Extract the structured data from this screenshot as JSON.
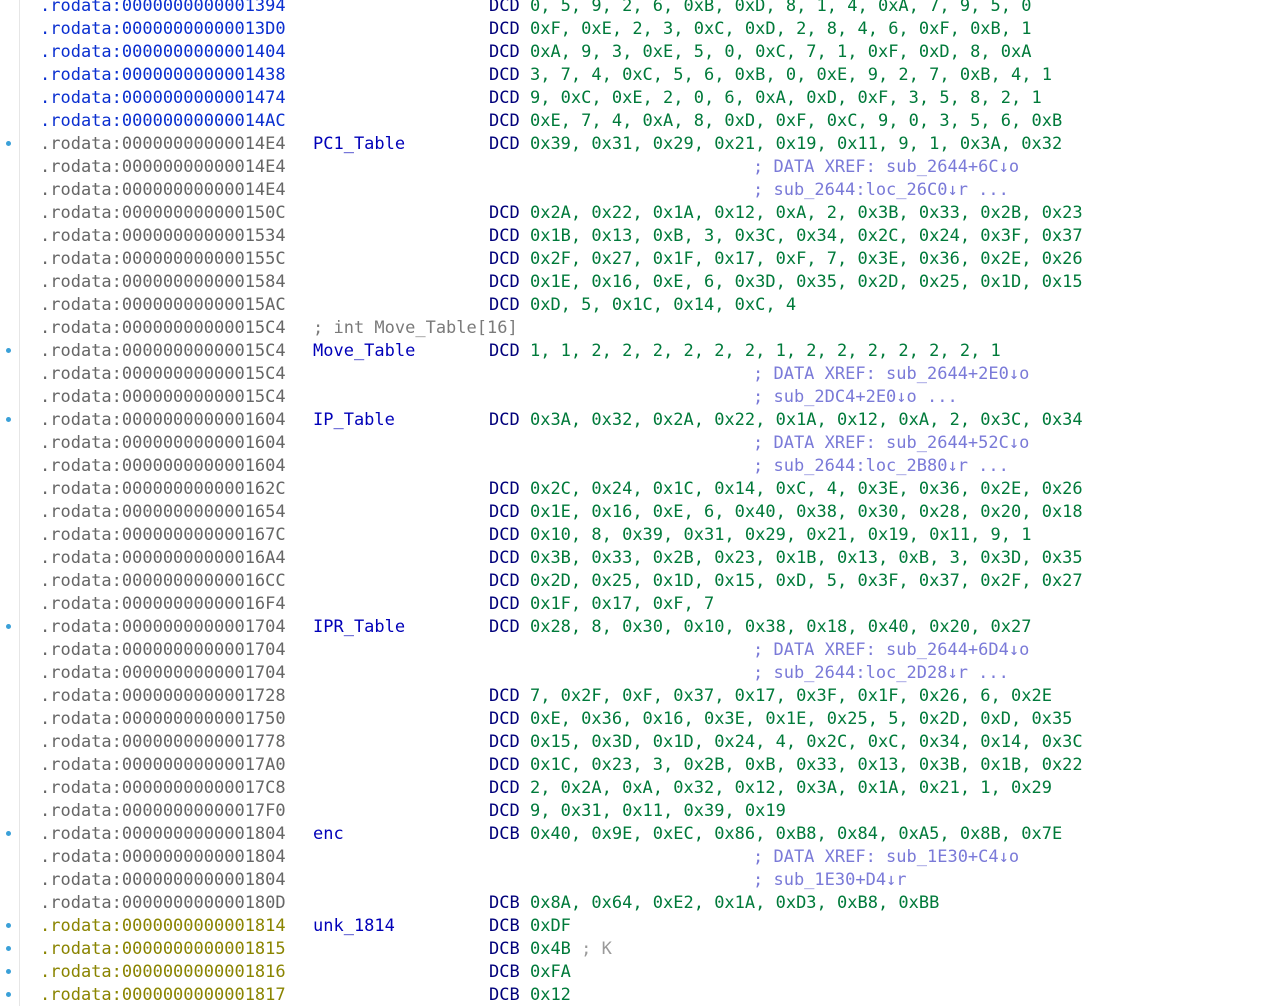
{
  "rows": [
    {
      "addr": ".rodata:0000000000001394",
      "addr_color": "blue",
      "dot": false,
      "label": "",
      "comment_label": "",
      "mnem": "DCD",
      "ops": "0, 5, 9, 2, 6, 0xB, 0xD, 8, 1, 4, 0xA, 7, 9, 5, 0",
      "inline_comment": "",
      "xref": ""
    },
    {
      "addr": ".rodata:00000000000013D0",
      "addr_color": "blue",
      "dot": false,
      "label": "",
      "comment_label": "",
      "mnem": "DCD",
      "ops": "0xF, 0xE, 2, 3, 0xC, 0xD, 2, 8, 4, 6, 0xF, 0xB, 1",
      "inline_comment": "",
      "xref": ""
    },
    {
      "addr": ".rodata:0000000000001404",
      "addr_color": "blue",
      "dot": false,
      "label": "",
      "comment_label": "",
      "mnem": "DCD",
      "ops": "0xA, 9, 3, 0xE, 5, 0, 0xC, 7, 1, 0xF, 0xD, 8, 0xA",
      "inline_comment": "",
      "xref": ""
    },
    {
      "addr": ".rodata:0000000000001438",
      "addr_color": "blue",
      "dot": false,
      "label": "",
      "comment_label": "",
      "mnem": "DCD",
      "ops": "3, 7, 4, 0xC, 5, 6, 0xB, 0, 0xE, 9, 2, 7, 0xB, 4, 1",
      "inline_comment": "",
      "xref": ""
    },
    {
      "addr": ".rodata:0000000000001474",
      "addr_color": "blue",
      "dot": false,
      "label": "",
      "comment_label": "",
      "mnem": "DCD",
      "ops": "9, 0xC, 0xE, 2, 0, 6, 0xA, 0xD, 0xF, 3, 5, 8, 2, 1",
      "inline_comment": "",
      "xref": ""
    },
    {
      "addr": ".rodata:00000000000014AC",
      "addr_color": "blue",
      "dot": false,
      "label": "",
      "comment_label": "",
      "mnem": "DCD",
      "ops": "0xE, 7, 4, 0xA, 8, 0xD, 0xF, 0xC, 9, 0, 3, 5, 6, 0xB",
      "inline_comment": "",
      "xref": ""
    },
    {
      "addr": ".rodata:00000000000014E4",
      "addr_color": "gray",
      "dot": true,
      "label": "PC1_Table",
      "comment_label": "",
      "mnem": "DCD",
      "ops": "0x39, 0x31, 0x29, 0x21, 0x19, 0x11, 9, 1, 0x3A, 0x32",
      "inline_comment": "",
      "xref": ""
    },
    {
      "addr": ".rodata:00000000000014E4",
      "addr_color": "gray",
      "dot": false,
      "label": "",
      "comment_label": "",
      "mnem": "",
      "ops": "",
      "inline_comment": "",
      "xref": "; DATA XREF: sub_2644+6C↓o"
    },
    {
      "addr": ".rodata:00000000000014E4",
      "addr_color": "gray",
      "dot": false,
      "label": "",
      "comment_label": "",
      "mnem": "",
      "ops": "",
      "inline_comment": "",
      "xref": "; sub_2644:loc_26C0↓r ..."
    },
    {
      "addr": ".rodata:000000000000150C",
      "addr_color": "gray",
      "dot": false,
      "label": "",
      "comment_label": "",
      "mnem": "DCD",
      "ops": "0x2A, 0x22, 0x1A, 0x12, 0xA, 2, 0x3B, 0x33, 0x2B, 0x23",
      "inline_comment": "",
      "xref": ""
    },
    {
      "addr": ".rodata:0000000000001534",
      "addr_color": "gray",
      "dot": false,
      "label": "",
      "comment_label": "",
      "mnem": "DCD",
      "ops": "0x1B, 0x13, 0xB, 3, 0x3C, 0x34, 0x2C, 0x24, 0x3F, 0x37",
      "inline_comment": "",
      "xref": ""
    },
    {
      "addr": ".rodata:000000000000155C",
      "addr_color": "gray",
      "dot": false,
      "label": "",
      "comment_label": "",
      "mnem": "DCD",
      "ops": "0x2F, 0x27, 0x1F, 0x17, 0xF, 7, 0x3E, 0x36, 0x2E, 0x26",
      "inline_comment": "",
      "xref": ""
    },
    {
      "addr": ".rodata:0000000000001584",
      "addr_color": "gray",
      "dot": false,
      "label": "",
      "comment_label": "",
      "mnem": "DCD",
      "ops": "0x1E, 0x16, 0xE, 6, 0x3D, 0x35, 0x2D, 0x25, 0x1D, 0x15",
      "inline_comment": "",
      "xref": ""
    },
    {
      "addr": ".rodata:00000000000015AC",
      "addr_color": "gray",
      "dot": false,
      "label": "",
      "comment_label": "",
      "mnem": "DCD",
      "ops": "0xD, 5, 0x1C, 0x14, 0xC, 4",
      "inline_comment": "",
      "xref": ""
    },
    {
      "addr": ".rodata:00000000000015C4",
      "addr_color": "gray",
      "dot": false,
      "label": "",
      "comment_label": "; int Move_Table[16]",
      "mnem": "",
      "ops": "",
      "inline_comment": "",
      "xref": ""
    },
    {
      "addr": ".rodata:00000000000015C4",
      "addr_color": "gray",
      "dot": true,
      "label": "Move_Table",
      "comment_label": "",
      "mnem": "DCD",
      "ops": "1, 1, 2, 2, 2, 2, 2, 2, 1, 2, 2, 2, 2, 2, 2, 1",
      "inline_comment": "",
      "xref": ""
    },
    {
      "addr": ".rodata:00000000000015C4",
      "addr_color": "gray",
      "dot": false,
      "label": "",
      "comment_label": "",
      "mnem": "",
      "ops": "",
      "inline_comment": "",
      "xref": "; DATA XREF: sub_2644+2E0↓o"
    },
    {
      "addr": ".rodata:00000000000015C4",
      "addr_color": "gray",
      "dot": false,
      "label": "",
      "comment_label": "",
      "mnem": "",
      "ops": "",
      "inline_comment": "",
      "xref": "; sub_2DC4+2E0↓o ..."
    },
    {
      "addr": ".rodata:0000000000001604",
      "addr_color": "gray",
      "dot": true,
      "label": "IP_Table",
      "comment_label": "",
      "mnem": "DCD",
      "ops": "0x3A, 0x32, 0x2A, 0x22, 0x1A, 0x12, 0xA, 2, 0x3C, 0x34",
      "inline_comment": "",
      "xref": ""
    },
    {
      "addr": ".rodata:0000000000001604",
      "addr_color": "gray",
      "dot": false,
      "label": "",
      "comment_label": "",
      "mnem": "",
      "ops": "",
      "inline_comment": "",
      "xref": "; DATA XREF: sub_2644+52C↓o"
    },
    {
      "addr": ".rodata:0000000000001604",
      "addr_color": "gray",
      "dot": false,
      "label": "",
      "comment_label": "",
      "mnem": "",
      "ops": "",
      "inline_comment": "",
      "xref": "; sub_2644:loc_2B80↓r ..."
    },
    {
      "addr": ".rodata:000000000000162C",
      "addr_color": "gray",
      "dot": false,
      "label": "",
      "comment_label": "",
      "mnem": "DCD",
      "ops": "0x2C, 0x24, 0x1C, 0x14, 0xC, 4, 0x3E, 0x36, 0x2E, 0x26",
      "inline_comment": "",
      "xref": ""
    },
    {
      "addr": ".rodata:0000000000001654",
      "addr_color": "gray",
      "dot": false,
      "label": "",
      "comment_label": "",
      "mnem": "DCD",
      "ops": "0x1E, 0x16, 0xE, 6, 0x40, 0x38, 0x30, 0x28, 0x20, 0x18",
      "inline_comment": "",
      "xref": ""
    },
    {
      "addr": ".rodata:000000000000167C",
      "addr_color": "gray",
      "dot": false,
      "label": "",
      "comment_label": "",
      "mnem": "DCD",
      "ops": "0x10, 8, 0x39, 0x31, 0x29, 0x21, 0x19, 0x11, 9, 1",
      "inline_comment": "",
      "xref": ""
    },
    {
      "addr": ".rodata:00000000000016A4",
      "addr_color": "gray",
      "dot": false,
      "label": "",
      "comment_label": "",
      "mnem": "DCD",
      "ops": "0x3B, 0x33, 0x2B, 0x23, 0x1B, 0x13, 0xB, 3, 0x3D, 0x35",
      "inline_comment": "",
      "xref": ""
    },
    {
      "addr": ".rodata:00000000000016CC",
      "addr_color": "gray",
      "dot": false,
      "label": "",
      "comment_label": "",
      "mnem": "DCD",
      "ops": "0x2D, 0x25, 0x1D, 0x15, 0xD, 5, 0x3F, 0x37, 0x2F, 0x27",
      "inline_comment": "",
      "xref": ""
    },
    {
      "addr": ".rodata:00000000000016F4",
      "addr_color": "gray",
      "dot": false,
      "label": "",
      "comment_label": "",
      "mnem": "DCD",
      "ops": "0x1F, 0x17, 0xF, 7",
      "inline_comment": "",
      "xref": ""
    },
    {
      "addr": ".rodata:0000000000001704",
      "addr_color": "gray",
      "dot": true,
      "label": "IPR_Table",
      "comment_label": "",
      "mnem": "DCD",
      "ops": "0x28, 8, 0x30, 0x10, 0x38, 0x18, 0x40, 0x20, 0x27",
      "inline_comment": "",
      "xref": ""
    },
    {
      "addr": ".rodata:0000000000001704",
      "addr_color": "gray",
      "dot": false,
      "label": "",
      "comment_label": "",
      "mnem": "",
      "ops": "",
      "inline_comment": "",
      "xref": "; DATA XREF: sub_2644+6D4↓o"
    },
    {
      "addr": ".rodata:0000000000001704",
      "addr_color": "gray",
      "dot": false,
      "label": "",
      "comment_label": "",
      "mnem": "",
      "ops": "",
      "inline_comment": "",
      "xref": "; sub_2644:loc_2D28↓r ..."
    },
    {
      "addr": ".rodata:0000000000001728",
      "addr_color": "gray",
      "dot": false,
      "label": "",
      "comment_label": "",
      "mnem": "DCD",
      "ops": "7, 0x2F, 0xF, 0x37, 0x17, 0x3F, 0x1F, 0x26, 6, 0x2E",
      "inline_comment": "",
      "xref": ""
    },
    {
      "addr": ".rodata:0000000000001750",
      "addr_color": "gray",
      "dot": false,
      "label": "",
      "comment_label": "",
      "mnem": "DCD",
      "ops": "0xE, 0x36, 0x16, 0x3E, 0x1E, 0x25, 5, 0x2D, 0xD, 0x35",
      "inline_comment": "",
      "xref": ""
    },
    {
      "addr": ".rodata:0000000000001778",
      "addr_color": "gray",
      "dot": false,
      "label": "",
      "comment_label": "",
      "mnem": "DCD",
      "ops": "0x15, 0x3D, 0x1D, 0x24, 4, 0x2C, 0xC, 0x34, 0x14, 0x3C",
      "inline_comment": "",
      "xref": ""
    },
    {
      "addr": ".rodata:00000000000017A0",
      "addr_color": "gray",
      "dot": false,
      "label": "",
      "comment_label": "",
      "mnem": "DCD",
      "ops": "0x1C, 0x23, 3, 0x2B, 0xB, 0x33, 0x13, 0x3B, 0x1B, 0x22",
      "inline_comment": "",
      "xref": ""
    },
    {
      "addr": ".rodata:00000000000017C8",
      "addr_color": "gray",
      "dot": false,
      "label": "",
      "comment_label": "",
      "mnem": "DCD",
      "ops": "2, 0x2A, 0xA, 0x32, 0x12, 0x3A, 0x1A, 0x21, 1, 0x29",
      "inline_comment": "",
      "xref": ""
    },
    {
      "addr": ".rodata:00000000000017F0",
      "addr_color": "gray",
      "dot": false,
      "label": "",
      "comment_label": "",
      "mnem": "DCD",
      "ops": "9, 0x31, 0x11, 0x39, 0x19",
      "inline_comment": "",
      "xref": ""
    },
    {
      "addr": ".rodata:0000000000001804",
      "addr_color": "gray",
      "dot": true,
      "label": "enc",
      "comment_label": "",
      "mnem": "DCB",
      "ops": "0x40, 0x9E, 0xEC, 0x86, 0xB8, 0x84, 0xA5, 0x8B, 0x7E",
      "inline_comment": "",
      "xref": ""
    },
    {
      "addr": ".rodata:0000000000001804",
      "addr_color": "gray",
      "dot": false,
      "label": "",
      "comment_label": "",
      "mnem": "",
      "ops": "",
      "inline_comment": "",
      "xref": "; DATA XREF: sub_1E30+C4↓o"
    },
    {
      "addr": ".rodata:0000000000001804",
      "addr_color": "gray",
      "dot": false,
      "label": "",
      "comment_label": "",
      "mnem": "",
      "ops": "",
      "inline_comment": "",
      "xref": "; sub_1E30+D4↓r"
    },
    {
      "addr": ".rodata:000000000000180D",
      "addr_color": "gray",
      "dot": false,
      "label": "",
      "comment_label": "",
      "mnem": "DCB",
      "ops": "0x8A, 0x64, 0xE2, 0x1A, 0xD3, 0xB8, 0xBB",
      "inline_comment": "",
      "xref": ""
    },
    {
      "addr": ".rodata:0000000000001814",
      "addr_color": "olive",
      "dot": true,
      "label": "unk_1814",
      "comment_label": "",
      "mnem": "DCB",
      "ops": "0xDF",
      "inline_comment": "",
      "xref": ""
    },
    {
      "addr": ".rodata:0000000000001815",
      "addr_color": "olive",
      "dot": true,
      "label": "",
      "comment_label": "",
      "mnem": "DCB",
      "ops": "0x4B",
      "inline_comment": " ; K",
      "xref": ""
    },
    {
      "addr": ".rodata:0000000000001816",
      "addr_color": "olive",
      "dot": true,
      "label": "",
      "comment_label": "",
      "mnem": "DCB",
      "ops": "0xFA",
      "inline_comment": "",
      "xref": ""
    },
    {
      "addr": ".rodata:0000000000001817",
      "addr_color": "olive",
      "dot": true,
      "label": "",
      "comment_label": "",
      "mnem": "DCB",
      "ops": "0x12",
      "inline_comment": "",
      "xref": ""
    }
  ]
}
